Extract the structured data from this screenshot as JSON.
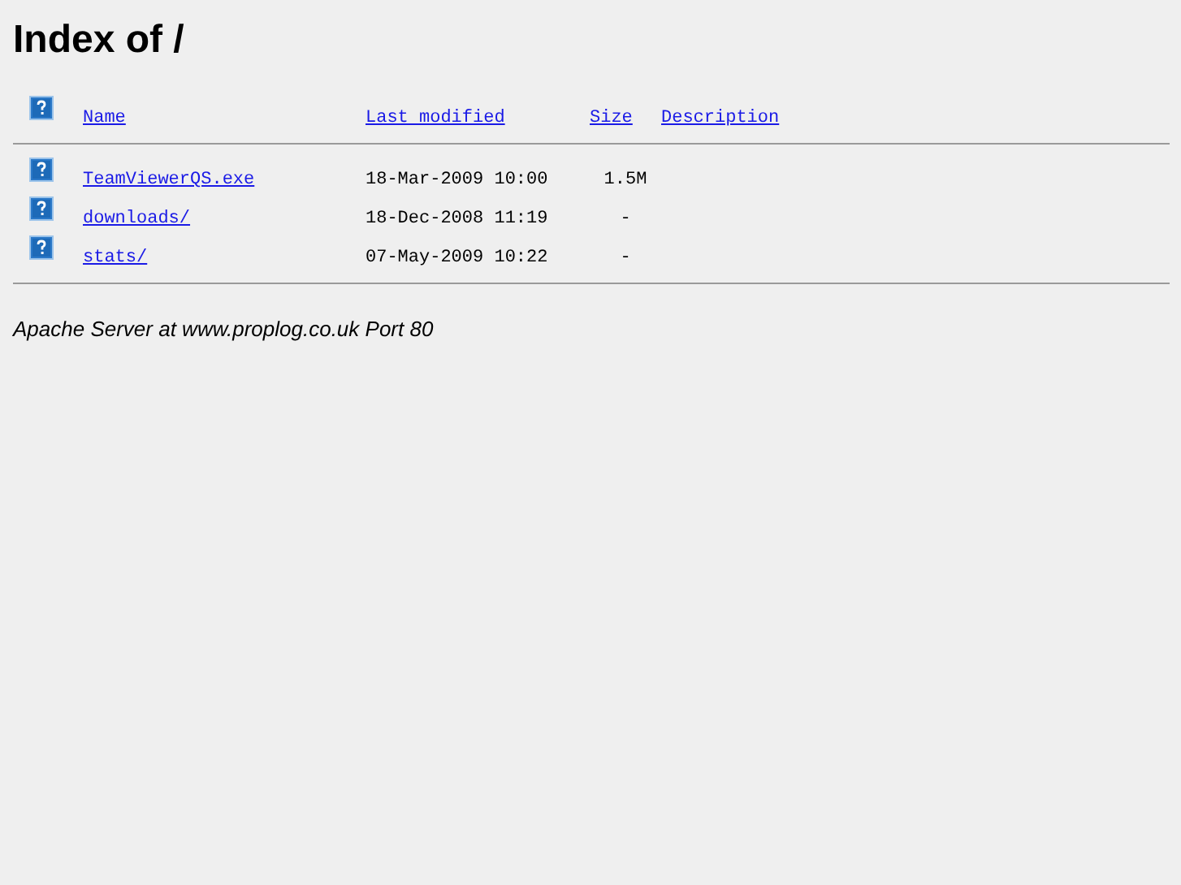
{
  "title": "Index of /",
  "columns": [
    "Name",
    "Last modified",
    "Size",
    "Description"
  ],
  "rows": [
    {
      "name": "TeamViewerQS.exe",
      "modified": "18-Mar-2009 10:00",
      "size": "1.5M"
    },
    {
      "name": "downloads/",
      "modified": "18-Dec-2008 11:19",
      "size": "-"
    },
    {
      "name": "stats/",
      "modified": "07-May-2009 10:22",
      "size": "-"
    }
  ],
  "footer": "Apache Server at www.proplog.co.uk Port 80"
}
